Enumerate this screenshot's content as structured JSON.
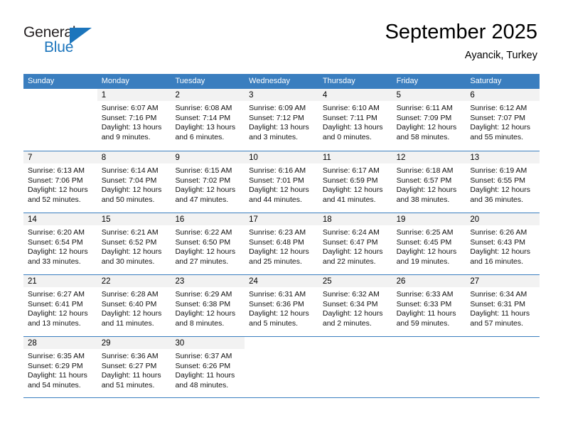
{
  "brand": {
    "name_part1": "General",
    "name_part2": "Blue",
    "accent_color": "#1c75bc"
  },
  "header": {
    "title": "September 2025",
    "location": "Ayancik, Turkey"
  },
  "calendar": {
    "header_bg": "#3a7ebf",
    "weekdays": [
      "Sunday",
      "Monday",
      "Tuesday",
      "Wednesday",
      "Thursday",
      "Friday",
      "Saturday"
    ],
    "weeks": [
      [
        {
          "day": "",
          "sunrise": "",
          "sunset": "",
          "daylight1": "",
          "daylight2": ""
        },
        {
          "day": "1",
          "sunrise": "Sunrise: 6:07 AM",
          "sunset": "Sunset: 7:16 PM",
          "daylight1": "Daylight: 13 hours",
          "daylight2": "and 9 minutes."
        },
        {
          "day": "2",
          "sunrise": "Sunrise: 6:08 AM",
          "sunset": "Sunset: 7:14 PM",
          "daylight1": "Daylight: 13 hours",
          "daylight2": "and 6 minutes."
        },
        {
          "day": "3",
          "sunrise": "Sunrise: 6:09 AM",
          "sunset": "Sunset: 7:12 PM",
          "daylight1": "Daylight: 13 hours",
          "daylight2": "and 3 minutes."
        },
        {
          "day": "4",
          "sunrise": "Sunrise: 6:10 AM",
          "sunset": "Sunset: 7:11 PM",
          "daylight1": "Daylight: 13 hours",
          "daylight2": "and 0 minutes."
        },
        {
          "day": "5",
          "sunrise": "Sunrise: 6:11 AM",
          "sunset": "Sunset: 7:09 PM",
          "daylight1": "Daylight: 12 hours",
          "daylight2": "and 58 minutes."
        },
        {
          "day": "6",
          "sunrise": "Sunrise: 6:12 AM",
          "sunset": "Sunset: 7:07 PM",
          "daylight1": "Daylight: 12 hours",
          "daylight2": "and 55 minutes."
        }
      ],
      [
        {
          "day": "7",
          "sunrise": "Sunrise: 6:13 AM",
          "sunset": "Sunset: 7:06 PM",
          "daylight1": "Daylight: 12 hours",
          "daylight2": "and 52 minutes."
        },
        {
          "day": "8",
          "sunrise": "Sunrise: 6:14 AM",
          "sunset": "Sunset: 7:04 PM",
          "daylight1": "Daylight: 12 hours",
          "daylight2": "and 50 minutes."
        },
        {
          "day": "9",
          "sunrise": "Sunrise: 6:15 AM",
          "sunset": "Sunset: 7:02 PM",
          "daylight1": "Daylight: 12 hours",
          "daylight2": "and 47 minutes."
        },
        {
          "day": "10",
          "sunrise": "Sunrise: 6:16 AM",
          "sunset": "Sunset: 7:01 PM",
          "daylight1": "Daylight: 12 hours",
          "daylight2": "and 44 minutes."
        },
        {
          "day": "11",
          "sunrise": "Sunrise: 6:17 AM",
          "sunset": "Sunset: 6:59 PM",
          "daylight1": "Daylight: 12 hours",
          "daylight2": "and 41 minutes."
        },
        {
          "day": "12",
          "sunrise": "Sunrise: 6:18 AM",
          "sunset": "Sunset: 6:57 PM",
          "daylight1": "Daylight: 12 hours",
          "daylight2": "and 38 minutes."
        },
        {
          "day": "13",
          "sunrise": "Sunrise: 6:19 AM",
          "sunset": "Sunset: 6:55 PM",
          "daylight1": "Daylight: 12 hours",
          "daylight2": "and 36 minutes."
        }
      ],
      [
        {
          "day": "14",
          "sunrise": "Sunrise: 6:20 AM",
          "sunset": "Sunset: 6:54 PM",
          "daylight1": "Daylight: 12 hours",
          "daylight2": "and 33 minutes."
        },
        {
          "day": "15",
          "sunrise": "Sunrise: 6:21 AM",
          "sunset": "Sunset: 6:52 PM",
          "daylight1": "Daylight: 12 hours",
          "daylight2": "and 30 minutes."
        },
        {
          "day": "16",
          "sunrise": "Sunrise: 6:22 AM",
          "sunset": "Sunset: 6:50 PM",
          "daylight1": "Daylight: 12 hours",
          "daylight2": "and 27 minutes."
        },
        {
          "day": "17",
          "sunrise": "Sunrise: 6:23 AM",
          "sunset": "Sunset: 6:48 PM",
          "daylight1": "Daylight: 12 hours",
          "daylight2": "and 25 minutes."
        },
        {
          "day": "18",
          "sunrise": "Sunrise: 6:24 AM",
          "sunset": "Sunset: 6:47 PM",
          "daylight1": "Daylight: 12 hours",
          "daylight2": "and 22 minutes."
        },
        {
          "day": "19",
          "sunrise": "Sunrise: 6:25 AM",
          "sunset": "Sunset: 6:45 PM",
          "daylight1": "Daylight: 12 hours",
          "daylight2": "and 19 minutes."
        },
        {
          "day": "20",
          "sunrise": "Sunrise: 6:26 AM",
          "sunset": "Sunset: 6:43 PM",
          "daylight1": "Daylight: 12 hours",
          "daylight2": "and 16 minutes."
        }
      ],
      [
        {
          "day": "21",
          "sunrise": "Sunrise: 6:27 AM",
          "sunset": "Sunset: 6:41 PM",
          "daylight1": "Daylight: 12 hours",
          "daylight2": "and 13 minutes."
        },
        {
          "day": "22",
          "sunrise": "Sunrise: 6:28 AM",
          "sunset": "Sunset: 6:40 PM",
          "daylight1": "Daylight: 12 hours",
          "daylight2": "and 11 minutes."
        },
        {
          "day": "23",
          "sunrise": "Sunrise: 6:29 AM",
          "sunset": "Sunset: 6:38 PM",
          "daylight1": "Daylight: 12 hours",
          "daylight2": "and 8 minutes."
        },
        {
          "day": "24",
          "sunrise": "Sunrise: 6:31 AM",
          "sunset": "Sunset: 6:36 PM",
          "daylight1": "Daylight: 12 hours",
          "daylight2": "and 5 minutes."
        },
        {
          "day": "25",
          "sunrise": "Sunrise: 6:32 AM",
          "sunset": "Sunset: 6:34 PM",
          "daylight1": "Daylight: 12 hours",
          "daylight2": "and 2 minutes."
        },
        {
          "day": "26",
          "sunrise": "Sunrise: 6:33 AM",
          "sunset": "Sunset: 6:33 PM",
          "daylight1": "Daylight: 11 hours",
          "daylight2": "and 59 minutes."
        },
        {
          "day": "27",
          "sunrise": "Sunrise: 6:34 AM",
          "sunset": "Sunset: 6:31 PM",
          "daylight1": "Daylight: 11 hours",
          "daylight2": "and 57 minutes."
        }
      ],
      [
        {
          "day": "28",
          "sunrise": "Sunrise: 6:35 AM",
          "sunset": "Sunset: 6:29 PM",
          "daylight1": "Daylight: 11 hours",
          "daylight2": "and 54 minutes."
        },
        {
          "day": "29",
          "sunrise": "Sunrise: 6:36 AM",
          "sunset": "Sunset: 6:27 PM",
          "daylight1": "Daylight: 11 hours",
          "daylight2": "and 51 minutes."
        },
        {
          "day": "30",
          "sunrise": "Sunrise: 6:37 AM",
          "sunset": "Sunset: 6:26 PM",
          "daylight1": "Daylight: 11 hours",
          "daylight2": "and 48 minutes."
        },
        {
          "day": "",
          "sunrise": "",
          "sunset": "",
          "daylight1": "",
          "daylight2": ""
        },
        {
          "day": "",
          "sunrise": "",
          "sunset": "",
          "daylight1": "",
          "daylight2": ""
        },
        {
          "day": "",
          "sunrise": "",
          "sunset": "",
          "daylight1": "",
          "daylight2": ""
        },
        {
          "day": "",
          "sunrise": "",
          "sunset": "",
          "daylight1": "",
          "daylight2": ""
        }
      ]
    ]
  }
}
